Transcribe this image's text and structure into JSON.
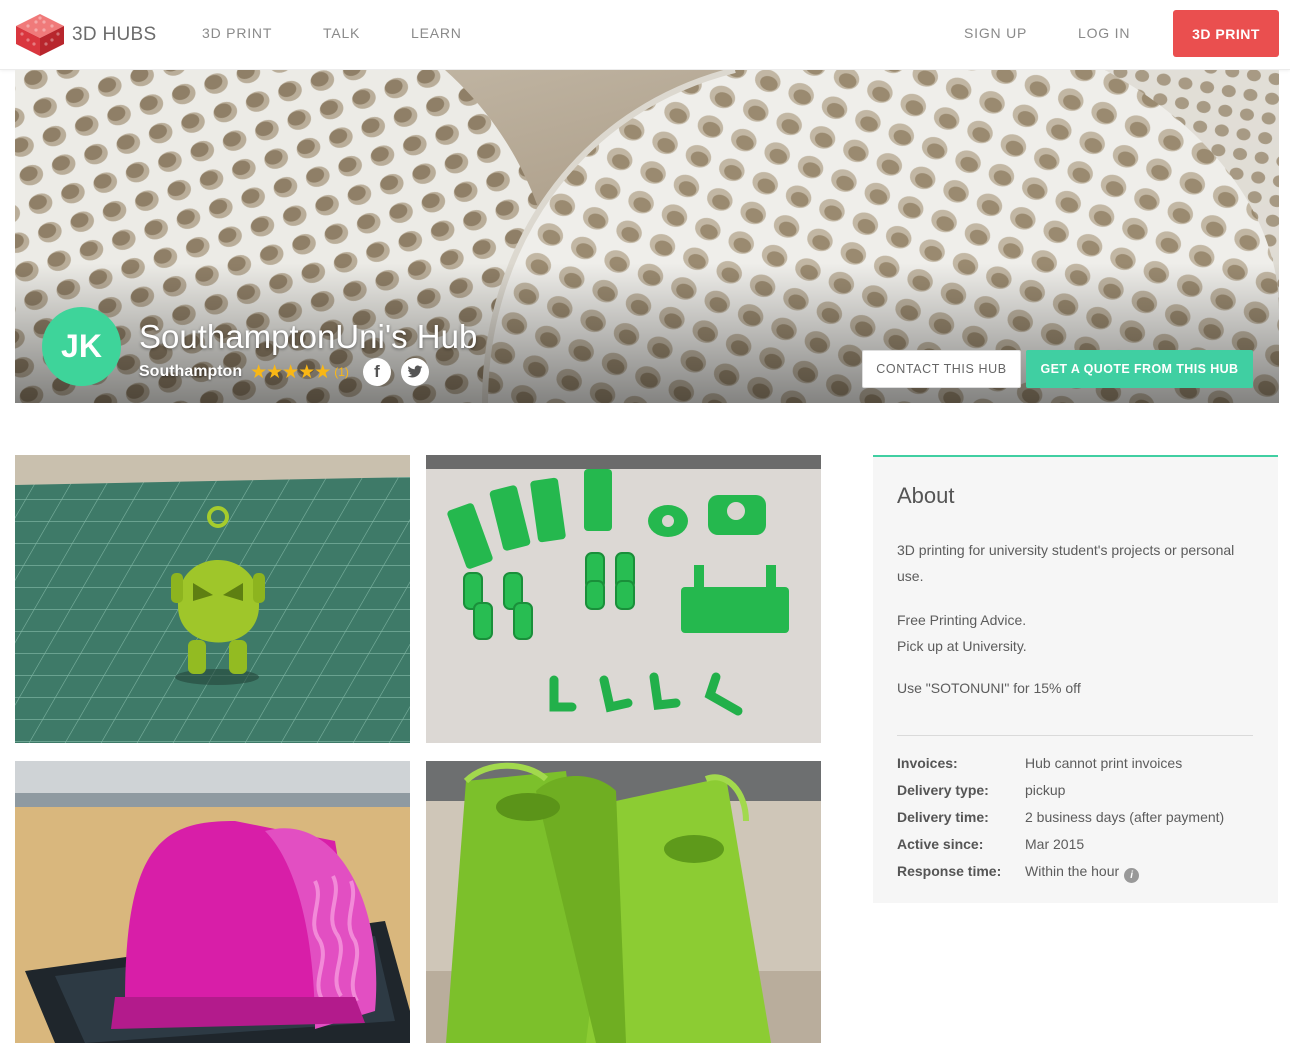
{
  "nav": {
    "brand": "3D HUBS",
    "links": [
      "3D PRINT",
      "TALK",
      "LEARN"
    ],
    "sign_up": "SIGN UP",
    "log_in": "LOG IN",
    "cta": "3D PRINT",
    "cta_color": "#ea4f4f"
  },
  "hero": {
    "avatar_initials": "JK",
    "avatar_color": "#3ed49a",
    "title": "SouthamptonUni's Hub",
    "location": "Southampton",
    "stars": "★★★★★",
    "rating": 5,
    "review_count": "(1)",
    "social_icons": [
      "facebook-icon",
      "twitter-icon"
    ],
    "contact_label": "CONTACT THIS HUB",
    "quote_label": "GET A QUOTE FROM THIS HUB",
    "accent_color": "#40cfa2"
  },
  "gallery": {
    "photos": [
      "lime-figurine-photo",
      "green-parts-photo",
      "pink-print-photo",
      "green-vase-photo"
    ]
  },
  "about": {
    "heading": "About",
    "paragraphs": [
      "3D printing for university student's projects or personal use.",
      "Free Printing Advice.",
      "Pick up at University.",
      "Use \"SOTONUNI\" for 15% off"
    ],
    "details": [
      {
        "label": "Invoices:",
        "value": "Hub cannot print invoices"
      },
      {
        "label": "Delivery type:",
        "value": "pickup"
      },
      {
        "label": "Delivery time:",
        "value": "2 business days (after payment)"
      },
      {
        "label": "Active since:",
        "value": "Mar 2015"
      },
      {
        "label": "Response time:",
        "value": "Within the hour"
      }
    ]
  }
}
